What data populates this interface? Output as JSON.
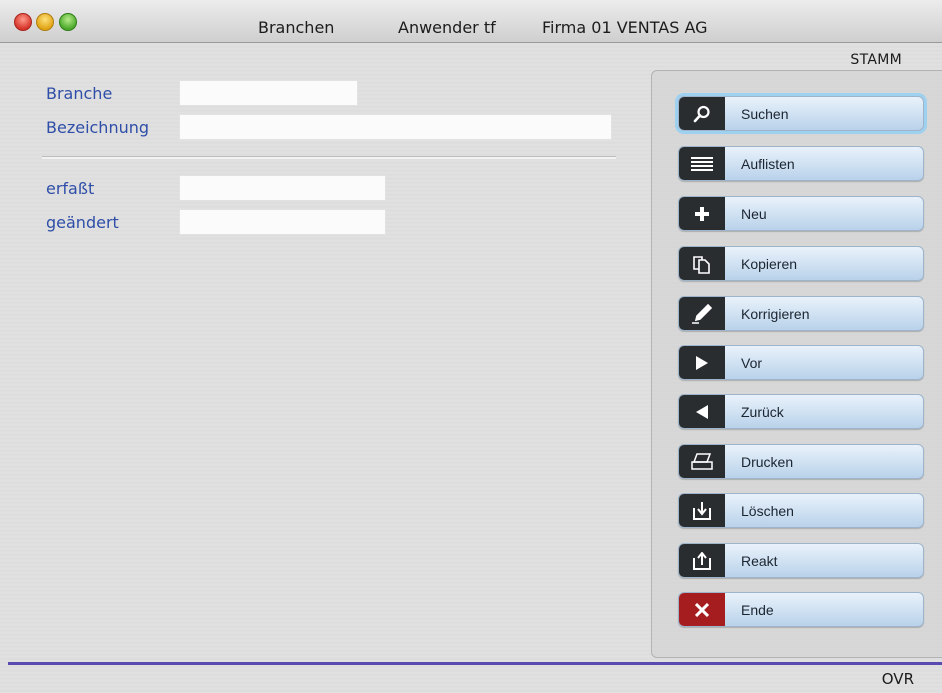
{
  "titlebar": {
    "title": "Branchen",
    "user": "Anwender tf",
    "company": "Firma 01 VENTAS AG"
  },
  "form": {
    "branche_label": "Branche",
    "branche_value": "",
    "bezeichnung_label": "Bezeichnung",
    "bezeichnung_value": "",
    "erfasst_label": "erfaßt",
    "erfasst_value": "",
    "geaendert_label": "geändert",
    "geaendert_value": ""
  },
  "panel": {
    "title": "STAMM",
    "buttons": [
      {
        "label": "Suchen",
        "icon": "search-icon"
      },
      {
        "label": "Auflisten",
        "icon": "list-icon"
      },
      {
        "label": "Neu",
        "icon": "plus-icon"
      },
      {
        "label": "Kopieren",
        "icon": "copy-icon"
      },
      {
        "label": "Korrigieren",
        "icon": "pen-icon"
      },
      {
        "label": "Vor",
        "icon": "forward-icon"
      },
      {
        "label": "Zurück",
        "icon": "back-icon"
      },
      {
        "label": "Drucken",
        "icon": "printer-icon"
      },
      {
        "label": "Löschen",
        "icon": "delete-icon"
      },
      {
        "label": "Reakt",
        "icon": "reactivate-icon"
      },
      {
        "label": "Ende",
        "icon": "close-icon"
      }
    ]
  },
  "status": {
    "mode": "OVR"
  },
  "colors": {
    "label_blue": "#2e4ea8",
    "status_line": "#5a4bb1",
    "end_red": "#a51d1f"
  }
}
